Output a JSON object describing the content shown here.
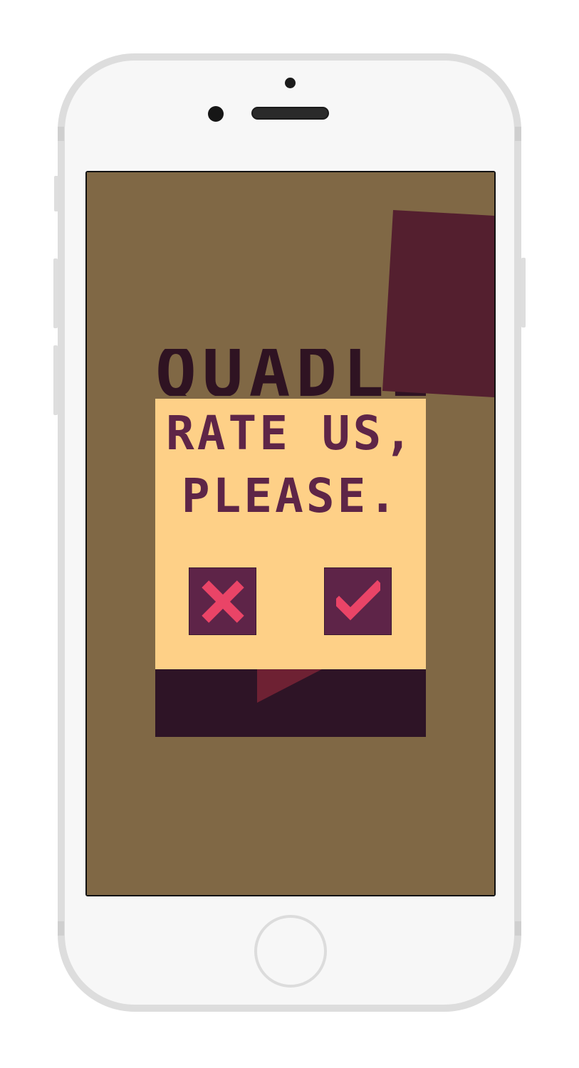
{
  "device": {
    "model": "iPhone",
    "frame_color": "#dddddd",
    "body_color": "#f7f7f7"
  },
  "game": {
    "title": "QUADLE",
    "background_color": "#806845",
    "dark_panel_color": "#541f2f",
    "strip_color": "#2e1426",
    "accent_shape_color": "#6e2133"
  },
  "rate_dialog": {
    "line1": "RATE US,",
    "line2": "PLEASE.",
    "background_color": "#fed087",
    "text_color": "#5e2547",
    "decline_button": {
      "icon": "close-x-icon",
      "color": "#ea4467"
    },
    "accept_button": {
      "icon": "checkmark-icon",
      "color": "#ea4467"
    }
  }
}
